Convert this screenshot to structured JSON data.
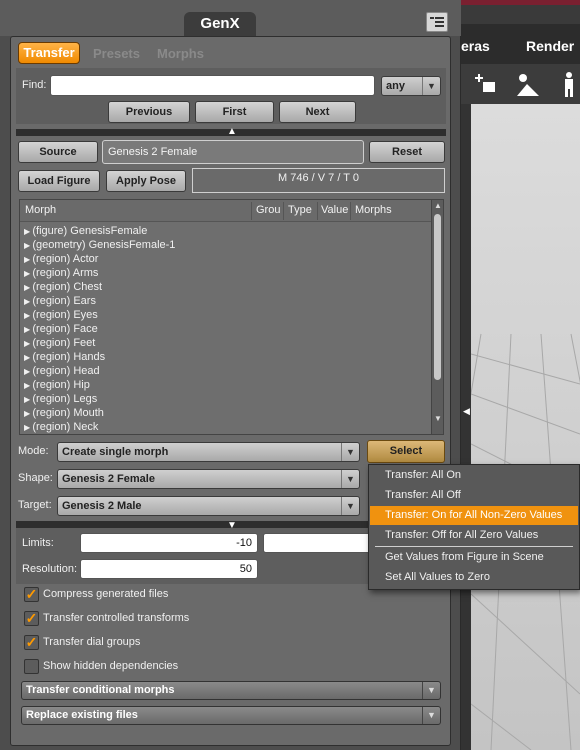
{
  "panel": {
    "title": "GenX",
    "tabs": [
      {
        "label": "Transfer",
        "active": true
      },
      {
        "label": "Presets",
        "active": false
      },
      {
        "label": "Morphs",
        "active": false
      }
    ]
  },
  "find": {
    "label": "Find:",
    "value": "",
    "filter": "any",
    "buttons": {
      "previous": "Previous",
      "first": "First",
      "next": "Next"
    }
  },
  "source": {
    "source_button": "Source",
    "value": "Genesis 2 Female",
    "reset_button": "Reset",
    "load_figure_button": "Load Figure",
    "apply_pose_button": "Apply Pose",
    "stats": "M 746 / V 7 / T 0"
  },
  "table": {
    "columns": [
      "Morph",
      "Grou",
      "Type",
      "Value",
      "Morphs"
    ],
    "rows": [
      "(figure) GenesisFemale",
      "(geometry) GenesisFemale-1",
      "(region) Actor",
      "(region) Arms",
      "(region) Chest",
      "(region) Ears",
      "(region) Eyes",
      "(region) Face",
      "(region) Feet",
      "(region) Hands",
      "(region) Head",
      "(region) Hip",
      "(region) Legs",
      "(region) Mouth",
      "(region) Neck"
    ]
  },
  "options": {
    "mode_label": "Mode:",
    "mode_value": "Create single morph",
    "select_button": "Select",
    "shape_label": "Shape:",
    "shape_value": "Genesis 2 Female",
    "target_label": "Target:",
    "target_value": "Genesis 2 Male"
  },
  "limits": {
    "limits_label": "Limits:",
    "min_value": "-10",
    "max_value": "",
    "resolution_label": "Resolution:",
    "resolution_value": "50"
  },
  "checkboxes": [
    {
      "label": "Compress generated files",
      "checked": true
    },
    {
      "label": "Transfer controlled transforms",
      "checked": true
    },
    {
      "label": "Transfer dial groups",
      "checked": true
    },
    {
      "label": "Show hidden dependencies",
      "checked": false
    }
  ],
  "bottom_dropdowns": {
    "conditional": "Transfer conditional morphs",
    "existing": "Replace existing files"
  },
  "popup_menu": {
    "items": [
      "Transfer: All On",
      "Transfer: All Off",
      "Transfer: On for All Non-Zero Values",
      "Transfer: Off for All Zero Values",
      "Get Values from Figure in Scene",
      "Set All Values to Zero"
    ],
    "highlighted_index": 2
  },
  "viewport": {
    "tabs": [
      "eras",
      "Render"
    ]
  },
  "colors": {
    "accent": "#f0920f",
    "panel_bg": "#6a6a6a",
    "check": "#ff9a00"
  }
}
